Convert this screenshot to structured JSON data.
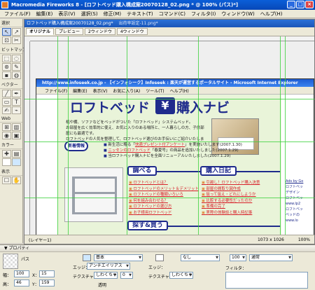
{
  "app": {
    "title": "Macromedia Fireworks 8 - [ロフトベッド購入構成案20070128_02.png * @ 100% (パス)*]",
    "window_buttons": [
      "_",
      "□",
      "×"
    ]
  },
  "menubar": [
    "ファイル(F)",
    "編集(E)",
    "表示(V)",
    "選択(S)",
    "修正(M)",
    "テキスト(T)",
    "コマンド(C)",
    "フィルタ(I)",
    "ウィンドウ(W)",
    "ヘルプ(H)"
  ],
  "tools": {
    "sections": [
      "選択",
      "ビットマップ",
      "ベクター",
      "Web",
      "カラー",
      "表示"
    ],
    "icons": [
      "↖",
      "↗",
      "⊡",
      "✂",
      "⬚",
      "◌",
      "⊛",
      "✎",
      "▪",
      "◍",
      "╱",
      "✒",
      "▭",
      "T",
      "✍",
      "⌁",
      "⊞",
      "▥",
      "◉",
      "▣",
      "✚",
      "▤",
      "☐",
      "✋"
    ]
  },
  "document": {
    "title": "ロフトベッド購入構成案20070128_02.png*",
    "title2": "出荷率設定-11.png*",
    "tabs": [
      "オリジナル",
      "プレビュー",
      "2ウィンドウ",
      "4ウィンドウ"
    ],
    "active_tab": "オリジナル",
    "status_left": "(レイヤー1)",
    "status_size": "1073 x 1026",
    "status_zoom": "100%"
  },
  "browser": {
    "title": "http://www.infoseek.co.jp - 【インフォシーク】Infoseek : 楽天が運営するポータルサイト - Microsoft Internet Explorer",
    "menu": [
      "ファイル(F)",
      "編集(E)",
      "表示(V)",
      "お気に入り(A)",
      "ツール(T)",
      "ヘルプ(H)"
    ]
  },
  "site": {
    "logo_left": "ロフトベッド",
    "logo_yen": "¥",
    "logo_right": "購入ナビ",
    "intro": [
      "机や棚、ソファなどをベッドがついた「ロフトベッド」システムベッド。",
      "お部屋を広く効率的に使え、お気に入れるスペースをもつことで住空間を有効に使うことができます。",
      "お部屋を広く効率的に使え、お気に入りのある場所と、一人暮らしの方、子供部屋にも最適です。",
      "ロフトベッドの人気を整理して、ロフトベッド選びのお手伝いにご紹介いたします。"
    ],
    "news_badge": "新着情報",
    "news": [
      {
        "pre": "新生活に贈る「",
        "hl": "快適プレゼント付アンケート",
        "post": "」を実施いたします(2007.1.30)"
      },
      {
        "pre": "",
        "hl": "ニッセンのロフトベッド",
        "post": "「春夏号」の商品を追加いたしました(2007.1.29)"
      },
      {
        "pre": "当ロフトベッド購入ナビを全面リニューアルいたしました(2007.1.29)",
        "hl": "",
        "post": ""
      }
    ],
    "section_search": "調べる",
    "section_diary": "購入日記",
    "section_buy": "探す&買う",
    "search_links": [
      "ロフトベッドとは？",
      "ロフトベッドのメリット＆デメリット",
      "ロフトベッドの種類いろいろ",
      "何を組み合わせる？",
      "ロフトベッドの選び方",
      "お子様用ロフトベッド"
    ],
    "diary_links": [
      "引越し！ロフトベッド購入決意",
      "部屋の間取り図作成",
      "狙って狙え・どれにしようか",
      "比較する必要性だったのか",
      "準備の完了",
      "実際の体験談と購入時記事"
    ],
    "ads_title": "Ads by Go",
    "ads": [
      "ロフトベッ",
      "デザイン",
      "ロフトベッ",
      "www.lp2",
      "ロフトベッ",
      "ベッドの",
      "www.lo"
    ]
  },
  "properties": {
    "header": "▼ プロパティ",
    "object_type": "パス",
    "fill_label": "基本",
    "edge_label": "エッジ：",
    "edge_value": "アンチエイリアス",
    "texture_label": "テクスチャ：",
    "texture_value": "しわくちゃ",
    "texture_pct": "0",
    "transparent_label": "透明",
    "stroke_value": "なし",
    "stroke_edge_label": "エッジ：",
    "stroke_texture_label": "テクスチャ：",
    "stroke_texture_value": "しわくちゃ",
    "opacity": "100",
    "blend": "通常",
    "filter_label": "フィルタ：",
    "w_label": "幅：",
    "w": "100",
    "x_label": "X：",
    "x": "15",
    "h_label": "高：",
    "h": "46",
    "y_label": "Y：",
    "y": "159"
  },
  "colors": {
    "brand_navy": "#1f2b8c",
    "link_red": "#d8202a",
    "guide_green": "#3bd13b",
    "page_green": "#e9f4d9"
  }
}
